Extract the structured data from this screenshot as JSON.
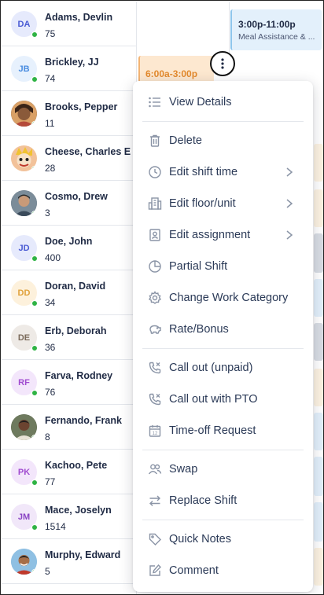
{
  "staff": [
    {
      "initials": "DA",
      "name": "Adams, Devlin",
      "count": "75",
      "avatar_bg": "#e6eafc",
      "avatar_fg": "#4a5bd4"
    },
    {
      "initials": "JB",
      "name": "Brickley, JJ",
      "count": "74",
      "avatar_bg": "#e7f1fd",
      "avatar_fg": "#4a8de0"
    },
    {
      "initials": "",
      "name": "Brooks, Pepper",
      "count": "11",
      "avatar_bg": "#6b4b3a",
      "avatar_fg": "#fff"
    },
    {
      "initials": "",
      "name": "Cheese, Charles E",
      "count": "28",
      "avatar_bg": "#f6d6b8",
      "avatar_fg": "#fff"
    },
    {
      "initials": "",
      "name": "Cosmo, Drew",
      "count": "3",
      "avatar_bg": "#5b6b78",
      "avatar_fg": "#fff"
    },
    {
      "initials": "JD",
      "name": "Doe, John",
      "count": "400",
      "avatar_bg": "#e6eafc",
      "avatar_fg": "#4a5bd4"
    },
    {
      "initials": "DD",
      "name": "Doran, David",
      "count": "34",
      "avatar_bg": "#fdf1dc",
      "avatar_fg": "#e0a23b"
    },
    {
      "initials": "DE",
      "name": "Erb, Deborah",
      "count": "36",
      "avatar_bg": "#eeeae6",
      "avatar_fg": "#7a6a5a"
    },
    {
      "initials": "RF",
      "name": "Farva, Rodney",
      "count": "76",
      "avatar_bg": "#f3e6fb",
      "avatar_fg": "#a04bd0"
    },
    {
      "initials": "",
      "name": "Fernando, Frank",
      "count": "8",
      "avatar_bg": "#4d5a43",
      "avatar_fg": "#fff"
    },
    {
      "initials": "PK",
      "name": "Kachoo, Pete",
      "count": "77",
      "avatar_bg": "#f3e6fb",
      "avatar_fg": "#a04bd0"
    },
    {
      "initials": "JM",
      "name": "Mace, Joselyn",
      "count": "1514",
      "avatar_bg": "#f1e7f9",
      "avatar_fg": "#8a45c4"
    },
    {
      "initials": "",
      "name": "Murphy, Edward",
      "count": "5",
      "avatar_bg": "#7ab0d8",
      "avatar_fg": "#fff"
    }
  ],
  "shifts": {
    "adams": {
      "time": "3:00p-11:00p",
      "category": "Meal Assistance & ..."
    },
    "brickley": {
      "time": "6:00a-3:00p"
    }
  },
  "colors": {
    "online": "#2fb344",
    "shift_blue": "#e3f0fb",
    "shift_orange": "#fde8d0",
    "shift_orange_text": "#e38a2e"
  },
  "menu": {
    "items": [
      {
        "label": "View Details",
        "icon": "list-icon",
        "submenu": false
      },
      {
        "label": "Delete",
        "icon": "trash-icon",
        "submenu": false
      },
      {
        "label": "Edit shift time",
        "icon": "clock-icon",
        "submenu": true
      },
      {
        "label": "Edit floor/unit",
        "icon": "building-icon",
        "submenu": true
      },
      {
        "label": "Edit assignment",
        "icon": "assignment-icon",
        "submenu": true
      },
      {
        "label": "Partial Shift",
        "icon": "partial-clock-icon",
        "submenu": false
      },
      {
        "label": "Change Work Category",
        "icon": "gear-icon",
        "submenu": false
      },
      {
        "label": "Rate/Bonus",
        "icon": "piggy-bank-icon",
        "submenu": false
      },
      {
        "label": "Call out (unpaid)",
        "icon": "phone-x-icon",
        "submenu": false
      },
      {
        "label": "Call out with PTO",
        "icon": "phone-x-icon",
        "submenu": false
      },
      {
        "label": "Time-off Request",
        "icon": "calendar-12-icon",
        "submenu": false
      },
      {
        "label": "Swap",
        "icon": "users-icon",
        "submenu": false
      },
      {
        "label": "Replace Shift",
        "icon": "swap-arrows-icon",
        "submenu": false
      },
      {
        "label": "Quick Notes",
        "icon": "tag-icon",
        "submenu": false
      },
      {
        "label": "Comment",
        "icon": "edit-icon",
        "submenu": false
      }
    ]
  }
}
